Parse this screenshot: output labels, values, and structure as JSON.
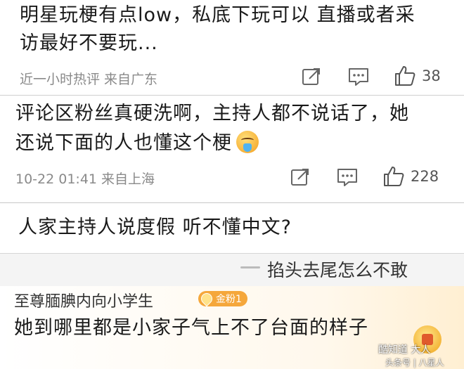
{
  "comments": [
    {
      "text_line1": "明星玩梗有点low，私底下玩可以 直播或者采",
      "text_line2": "访最好不要玩...",
      "meta": "近一小时热评  来自广东",
      "likes": "38"
    },
    {
      "text_line1": "评论区粉丝真硬洗啊，主持人都不说话了，她",
      "text_line2": "还说下面的人也懂这个梗",
      "meta": "10-22 01:41  来自上海",
      "likes": "228"
    }
  ],
  "reply_box": {
    "text": "人家主持人说度假 听不懂中文?"
  },
  "danmaku": {
    "quote": "掐头去尾怎么不敢"
  },
  "fan_comment": {
    "username": "至尊腼腆内向小学生",
    "badge": "金粉1",
    "text": "她到哪里都是小家子气上不了台面的样子"
  },
  "watermark": {
    "text": "酷知道 大人",
    "source": "头条号 | 八星人"
  },
  "icons": {
    "share": "share-icon",
    "comment": "comment-icon",
    "like": "thumbs-up-icon",
    "reply": "reply-icon",
    "gift": "gift-icon"
  }
}
